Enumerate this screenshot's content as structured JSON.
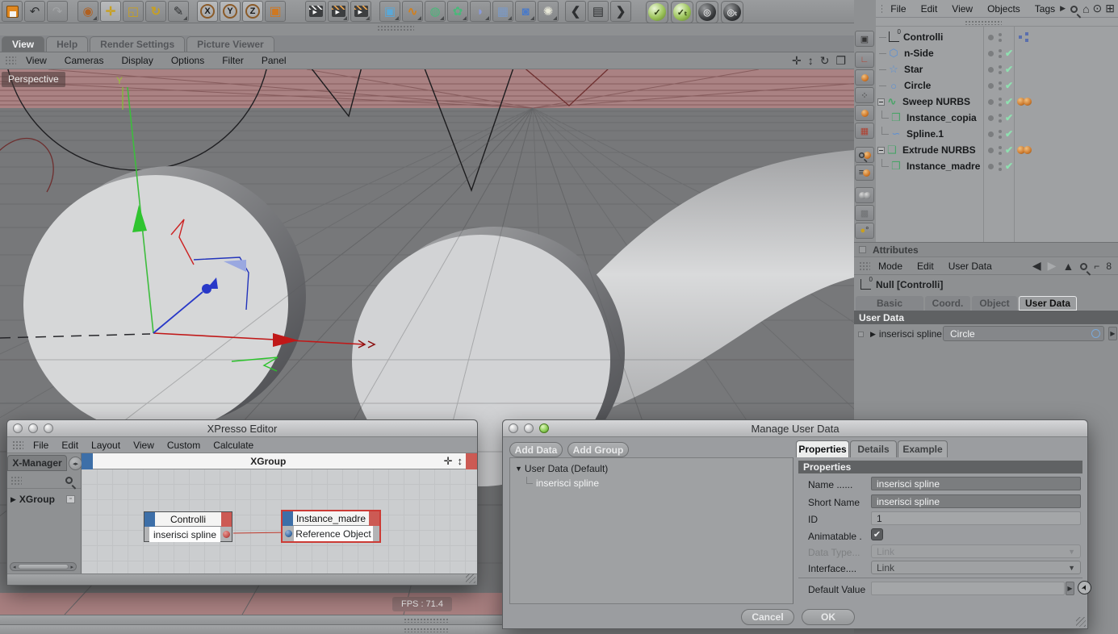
{
  "toolbar": {
    "axis": [
      "X",
      "Y",
      "Z"
    ],
    "icons": [
      "save",
      "undo",
      "redo",
      "live-selection",
      "move",
      "scale",
      "rotate",
      "spline-pen",
      "lock-x",
      "lock-y",
      "lock-z",
      "coordinate-system",
      "render-view",
      "render-active",
      "render-settings",
      "add-cube",
      "add-spline",
      "add-nurbs",
      "add-array",
      "add-shell",
      "add-floor",
      "add-camera",
      "add-light",
      "previous",
      "scene-browser",
      "next",
      "green-check",
      "green-check-t",
      "dark-sphere",
      "dark-sphere-t"
    ]
  },
  "glyphs": {
    "undo": "↶",
    "redo": "↷",
    "selection": "◉",
    "move": "✛",
    "scale": "◱",
    "rotate": "↻",
    "pen": "✎",
    "cube": "▣",
    "spline": "∿",
    "nurbs": "◍",
    "array": "✿",
    "shell": "◗",
    "floor": "▦",
    "camera": "◙",
    "light": "✺",
    "prev": "❮",
    "next": "❯",
    "doc": "▤",
    "arrow_left": "◀",
    "arrow_right": "▶",
    "arrow_up": "▲",
    "home": "⌂",
    "eye": "⊙",
    "plusbox": "⊞",
    "maximize": "❐",
    "updown": "↕",
    "fourway": "✛",
    "tree_closed": "▶",
    "tree_open": "▼",
    "check": "✔",
    "dropdown": "▼",
    "side": "▶",
    "pick": "➤",
    "circles8": "8"
  },
  "viewport": {
    "tabs": [
      "View",
      "Help",
      "Render Settings",
      "Picture Viewer"
    ],
    "active_tab": "View",
    "menu": [
      "View",
      "Cameras",
      "Display",
      "Options",
      "Filter",
      "Panel"
    ],
    "label": "Perspective",
    "fps": "FPS : 71.4",
    "axis_label": "Y"
  },
  "object_manager": {
    "menu": [
      "File",
      "Edit",
      "View",
      "Objects",
      "Tags"
    ],
    "items": [
      {
        "name": "Controlli",
        "icon": "null-object",
        "level": 0,
        "enabled": false,
        "tags": [
          "xpresso"
        ]
      },
      {
        "name": "n-Side",
        "icon": "nside-spline",
        "glyph": "⬡",
        "level": 0,
        "enabled": true
      },
      {
        "name": "Star",
        "icon": "star-spline",
        "glyph": "☆",
        "level": 0,
        "enabled": true
      },
      {
        "name": "Circle",
        "icon": "circle-spline",
        "glyph": "○",
        "level": 0,
        "enabled": true
      },
      {
        "name": "Sweep NURBS",
        "icon": "sweep-nurbs",
        "glyph": "∿",
        "level": 0,
        "expanded": true,
        "enabled": true,
        "tags": [
          "smoothing",
          "smoothing"
        ]
      },
      {
        "name": "Instance_copia",
        "icon": "instance",
        "glyph": "❒",
        "level": 1,
        "enabled": true
      },
      {
        "name": "Spline.1",
        "icon": "spline",
        "glyph": "∽",
        "level": 1,
        "enabled": true
      },
      {
        "name": "Extrude NURBS",
        "icon": "extrude-nurbs",
        "glyph": "❏",
        "level": 0,
        "expanded": true,
        "enabled": true,
        "tags": [
          "smoothing",
          "smoothing"
        ]
      },
      {
        "name": "Instance_madre",
        "icon": "instance",
        "glyph": "❒",
        "level": 1,
        "enabled": true
      }
    ]
  },
  "attributes": {
    "title": "Attributes",
    "menu": [
      "Mode",
      "Edit",
      "User Data"
    ],
    "object_label": "Null [Controlli]",
    "tabs": [
      "Basic",
      "Coord.",
      "Object",
      "User Data"
    ],
    "active_tab": "User Data",
    "section": "User Data",
    "param_label": "inserisci spline",
    "param_value": "Circle"
  },
  "xpresso": {
    "title": "XPresso Editor",
    "menu": [
      "File",
      "Edit",
      "Layout",
      "View",
      "Custom",
      "Calculate"
    ],
    "sidebar_tab": "X-Manager",
    "tree_item": "XGroup",
    "group_title": "XGroup",
    "nodes": [
      {
        "title": "Controlli",
        "port": "inserisci spline",
        "port_side": "output"
      },
      {
        "title": "Instance_madre",
        "port": "Reference Object",
        "port_side": "input",
        "selected": true
      }
    ]
  },
  "dialog": {
    "title": "Manage User Data",
    "add_data": "Add Data",
    "add_group": "Add Group",
    "tabs": [
      "Properties",
      "Details",
      "Example"
    ],
    "active_tab": "Properties",
    "tree_root": "User Data (Default)",
    "tree_child": "inserisci spline",
    "properties": {
      "header": "Properties",
      "name_label": "Name ......",
      "name_value": "inserisci spline",
      "short_label": "Short Name",
      "short_value": "inserisci spline",
      "id_label": "ID",
      "id_value": "1",
      "anim_label": "Animatable .",
      "anim_checked": true,
      "datatype_label": "Data Type...",
      "datatype_value": "Link",
      "interface_label": "Interface....",
      "interface_value": "Link",
      "default_label": "Default Value"
    },
    "cancel": "Cancel",
    "ok": "OK"
  },
  "colors": {
    "accent_red": "#cc3b35",
    "port_blue": "#3d6fa8",
    "check_green": "#8fe0b0",
    "tag_orange": "#cd7a2e",
    "band_red": "#aa8283"
  }
}
